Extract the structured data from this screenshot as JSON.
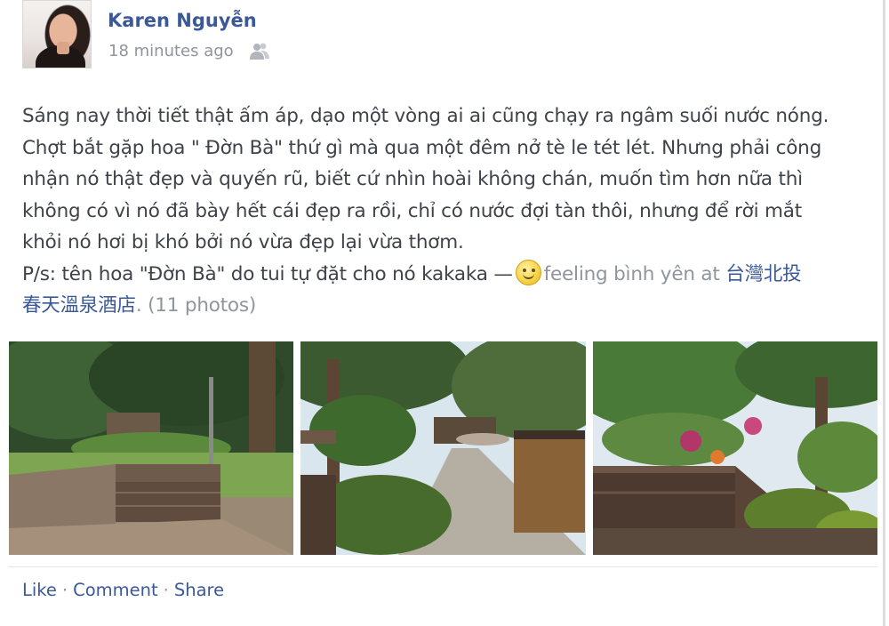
{
  "post": {
    "author": "Karen Nguyễn",
    "timestamp": "18 minutes ago",
    "privacy_icon": "friends-icon",
    "text_lines": [
      "Sáng nay thời tiết thật ấm áp, dạo một vòng ai ai cũng chạy ra ngâm suối nước nóng.",
      "Chợt bắt gặp hoa \" Đờn Bà\" thứ gì mà qua một đêm nở tè le tét lét. Nhưng phải công",
      "nhận nó thật đẹp và quyến rũ, biết cứ nhìn hoài không chán, muốn tìm hơn nữa thì",
      "không có vì nó đã bày hết cái đẹp ra rồi, chỉ có nước đợi tàn thôi, nhưng để rời mắt",
      "khỏi nó hơi bị khó bởi nó vừa đẹp lại vừa thơm."
    ],
    "ps_text": "P/s: tên hoa \"Đờn Bà\" do tui tự đặt cho nó kakaka —",
    "feeling_icon": "smiley-icon",
    "feeling_text": "feeling bình yên at",
    "location_line1": "台灣北投",
    "location_line2": "春天溫泉酒店",
    "photo_count": "(11 photos)",
    "photos": [
      {
        "icon": "photo-bench-garden"
      },
      {
        "icon": "photo-garden-path"
      },
      {
        "icon": "photo-garden-flowers"
      }
    ]
  },
  "actions": {
    "like": "Like",
    "comment": "Comment",
    "share": "Share",
    "separator": "·"
  },
  "colors": {
    "link": "#3b5998",
    "muted": "#90949c",
    "text": "#3e4249"
  }
}
